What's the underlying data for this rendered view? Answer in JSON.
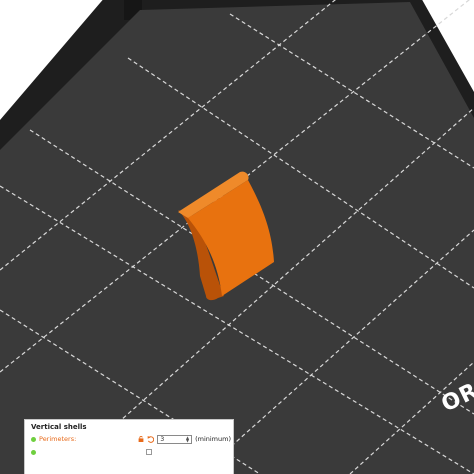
{
  "viewport": {
    "background_color": "#ffffff",
    "bed_color": "#2e2e2e",
    "bed_frame_color": "#1e1e1e",
    "grid_color": "#d8d8d8",
    "model_color": "#e8720f",
    "model_shadow_color": "#b95208",
    "bed_brand": "ORI"
  },
  "settings_panel": {
    "title": "Vertical shells",
    "perimeters": {
      "label": "Perimeters:",
      "value": "3",
      "unit": "(minimum)"
    }
  }
}
